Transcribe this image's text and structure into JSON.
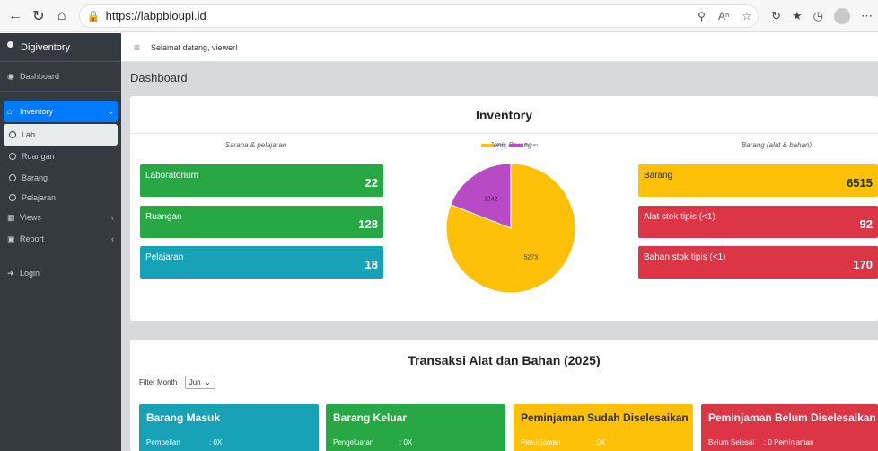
{
  "browser": {
    "url": "https://labpbioupi.id"
  },
  "sidebar": {
    "brand": "Digiventory",
    "items": [
      {
        "label": "Dashboard"
      },
      {
        "label": "Inventory"
      },
      {
        "label": "Lab"
      },
      {
        "label": "Ruangan"
      },
      {
        "label": "Barang"
      },
      {
        "label": "Pelajaran"
      },
      {
        "label": "Views"
      },
      {
        "label": "Report"
      },
      {
        "label": "Login"
      }
    ]
  },
  "header": {
    "greeting": "Selamat datang, viewer!"
  },
  "page": {
    "title": "Dashboard"
  },
  "inventory": {
    "title": "Inventory",
    "col1_title": "Sarana & pelajaran",
    "col2_title": "Jenis Barang",
    "col3_title": "Barang (alat & bahan)",
    "left_stats": [
      {
        "label": "Laboratorium",
        "value": "22"
      },
      {
        "label": "Ruangan",
        "value": "128"
      },
      {
        "label": "Pelajaran",
        "value": "18"
      }
    ],
    "right_stats": [
      {
        "label": "Barang",
        "value": "6515"
      },
      {
        "label": "Alat stok tipis (<1)",
        "value": "92"
      },
      {
        "label": "Bahan stok tipis (<1)",
        "value": "170"
      }
    ]
  },
  "chart_data": {
    "type": "pie",
    "title": "Jenis Barang",
    "labels": [
      "Alat",
      "Bahan"
    ],
    "values": [
      5273,
      1242
    ],
    "colors": [
      "#ffc107",
      "#b84ac6"
    ],
    "legend": "top"
  },
  "transaksi": {
    "title": "Transaksi Alat dan Bahan (2025)",
    "filter_label": "Filter Month :",
    "filter_value": "Jun",
    "boxes": [
      {
        "title": "Barang Masuk",
        "label": "Pembelian",
        "value": ": 0X",
        "color": "#17a2b8"
      },
      {
        "title": "Barang Keluar",
        "label": "Pengeluaran",
        "value": ": 0X",
        "color": "#28a745"
      },
      {
        "title": "Peminjaman Sudah Diselesaikan",
        "label": "Peminjaman",
        "value": ": 0X",
        "color": "#ffc107"
      },
      {
        "title": "Peminjaman Belum Diselesaikan",
        "label": "Belum Selesai",
        "value": ": 0 Peminjaman",
        "color": "#dc3545"
      }
    ]
  }
}
